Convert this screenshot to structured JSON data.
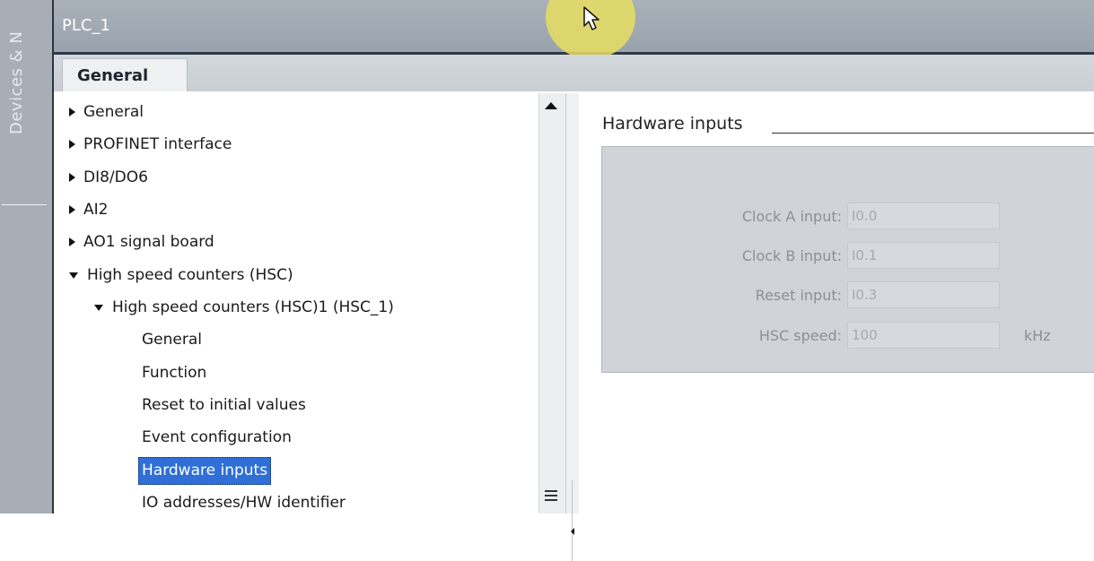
{
  "sidebar": {
    "label": "Devices & N"
  },
  "titlebar": {
    "title": "PLC_1"
  },
  "tabs": {
    "general": "General"
  },
  "tree": {
    "items": [
      {
        "label": "General",
        "expander": "right"
      },
      {
        "label": "PROFINET interface",
        "expander": "right"
      },
      {
        "label": "DI8/DO6",
        "expander": "right"
      },
      {
        "label": "AI2",
        "expander": "right"
      },
      {
        "label": "AO1 signal board",
        "expander": "right"
      },
      {
        "label": "High speed counters (HSC)",
        "expander": "down"
      },
      {
        "label": "High speed counters (HSC)1 (HSC_1)",
        "expander": "down"
      },
      {
        "label": "General"
      },
      {
        "label": "Function"
      },
      {
        "label": "Reset to initial values"
      },
      {
        "label": "Event configuration"
      },
      {
        "label": "Hardware inputs",
        "selected": true
      },
      {
        "label": "IO addresses/HW identifier"
      }
    ]
  },
  "content": {
    "section_title": "Hardware inputs",
    "fields": [
      {
        "label": "Clock A input:",
        "value": "I0.0"
      },
      {
        "label": "Clock B input:",
        "value": "I0.1"
      },
      {
        "label": "Reset input:",
        "value": "I0.3"
      },
      {
        "label": "HSC speed:",
        "value": "100",
        "unit": "kHz"
      }
    ]
  },
  "colors": {
    "selection": "#2f6fd6",
    "titlebar": "#9aa3ad",
    "panel_box": "#d0d4d8",
    "cursor_highlight": "#e8de60"
  }
}
